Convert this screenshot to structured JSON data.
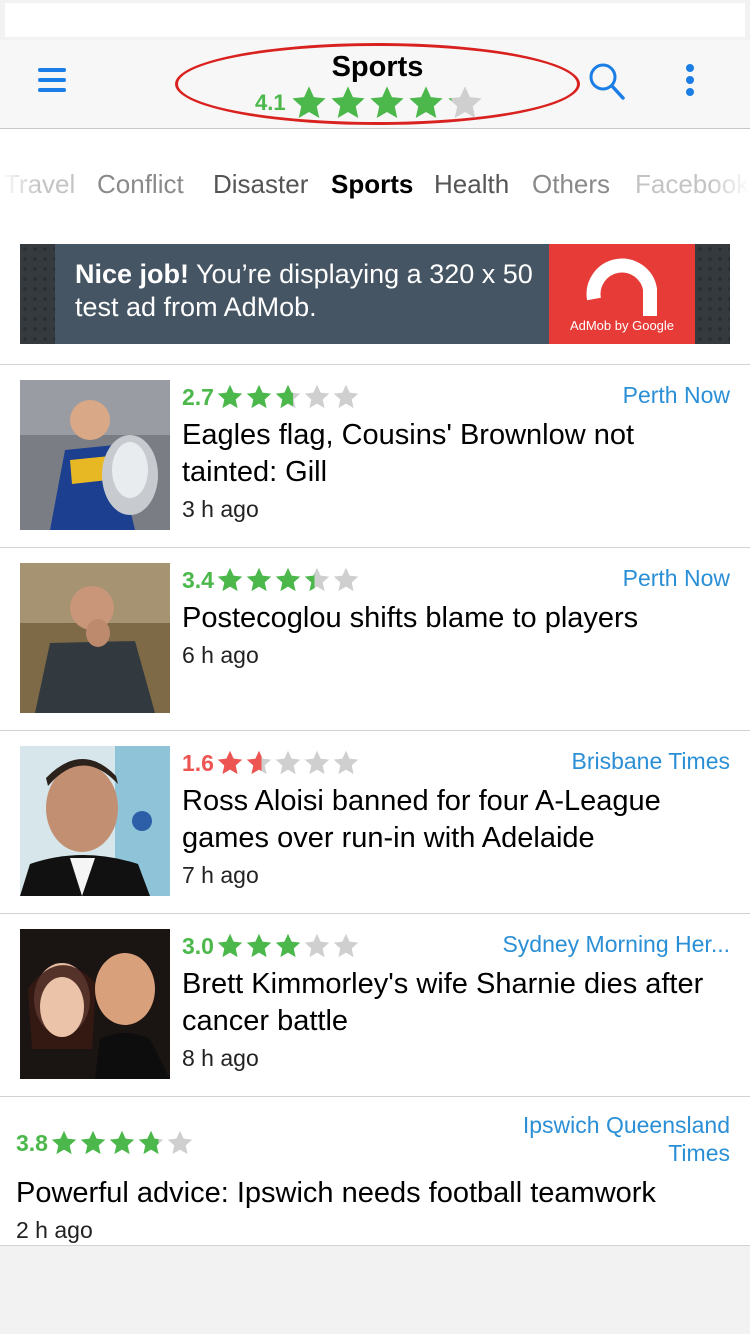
{
  "nav": {
    "title": "Sports",
    "rating": "4.1",
    "rating_value": 4.1
  },
  "tabs": [
    "Travel",
    "Conflict",
    "Disaster",
    "Sports",
    "Health",
    "Others",
    "Facebook"
  ],
  "active_tab": "Sports",
  "ad": {
    "bold": "Nice job!",
    "line1": " You’re displaying a 320 x 50",
    "line2": "test ad from AdMob.",
    "logo_caption": "AdMob by Google"
  },
  "articles": [
    {
      "rating": "2.7",
      "rating_value": 2.7,
      "rating_color": "#4cb84c",
      "source": "Perth Now",
      "headline": "Eagles flag, Cousins' Brownlow not tainted: Gill",
      "ago": "3 h ago"
    },
    {
      "rating": "3.4",
      "rating_value": 3.4,
      "rating_color": "#4cb84c",
      "source": "Perth Now",
      "headline": "Postecoglou shifts blame to players",
      "ago": "6 h ago"
    },
    {
      "rating": "1.6",
      "rating_value": 1.6,
      "rating_color": "#ec5552",
      "source": "Brisbane Times",
      "headline": "Ross Aloisi banned for four A-League games over run-in with Adelaide",
      "ago": "7 h ago"
    },
    {
      "rating": "3.0",
      "rating_value": 3.0,
      "rating_color": "#4cb84c",
      "source": "Sydney Morning Her...",
      "headline": "Brett Kimmorley's wife Sharnie dies after cancer battle",
      "ago": "8 h ago"
    },
    {
      "rating": "3.8",
      "rating_value": 3.8,
      "rating_color": "#4cb84c",
      "source_line1": "Ipswich Queensland",
      "source_line2": "Times",
      "headline": "Powerful advice: Ipswich needs football teamwork",
      "ago": "2 h ago"
    }
  ],
  "colors": {
    "accent": "#1a7ee6",
    "green": "#4cb84c",
    "red": "#ec5552",
    "link": "#2b8fd6",
    "highlight": "#d9221f"
  },
  "icons": [
    "menu-icon",
    "search-icon",
    "more-vertical-icon",
    "star-icon",
    "admob-logo-icon"
  ]
}
